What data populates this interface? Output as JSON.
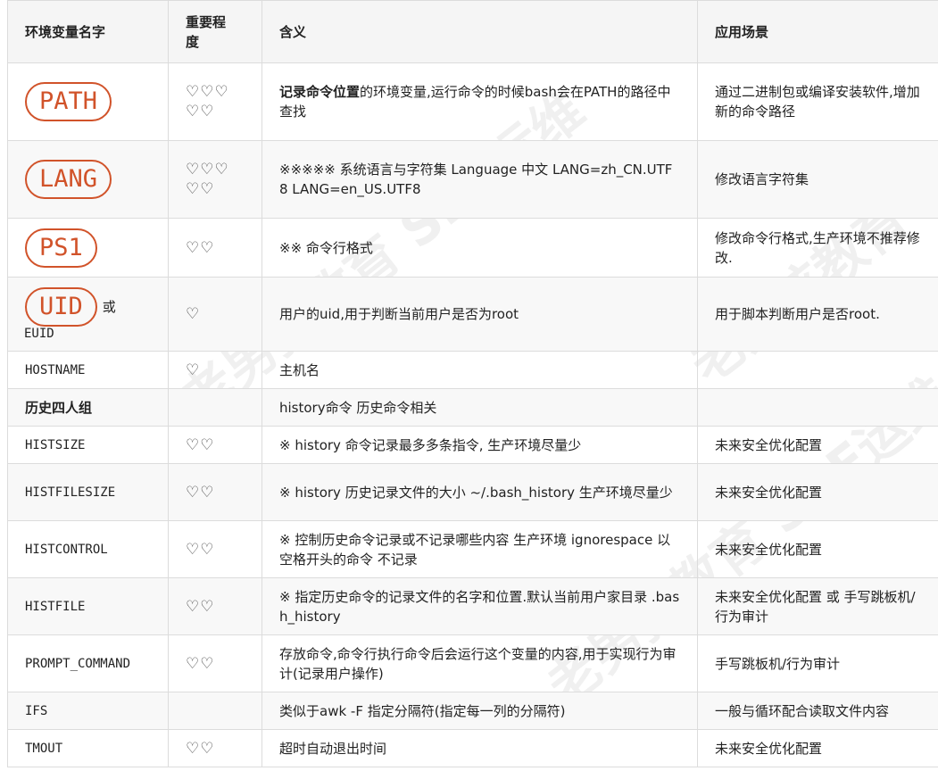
{
  "headers": [
    "环境变量名字",
    "重要程度",
    "含义",
    "应用场景"
  ],
  "watermark": "老男孩教育 SRE运维",
  "rows": [
    {
      "name": "PATH",
      "name_style": "pill",
      "extra": "",
      "hearts": "♡♡♡♡♡",
      "meaning_bold": "记录命令位置",
      "meaning": "的环境变量,运行命令的时候bash会在PATH的路径中查找",
      "scene": "通过二进制包或编译安装软件,增加新的命令路径"
    },
    {
      "name": "LANG",
      "name_style": "pill",
      "extra": "",
      "hearts": "♡♡♡♡♡",
      "meaning_bold": "",
      "meaning": "※※※※※ 系统语言与字符集 Language 中文 LANG=zh_CN.UTF8 LANG=en_US.UTF8",
      "scene": "修改语言字符集"
    },
    {
      "name": "PS1",
      "name_style": "pill",
      "extra": "",
      "hearts": "♡♡",
      "meaning_bold": "",
      "meaning": "※※ 命令行格式",
      "scene": "修改命令行格式,生产环境不推荐修改."
    },
    {
      "name": "UID",
      "name_style": "pill",
      "extra": "或",
      "extra2": "EUID",
      "hearts": "♡",
      "meaning_bold": "",
      "meaning": "用户的uid,用于判断当前用户是否为root",
      "scene": "用于脚本判断用户是否root."
    },
    {
      "name": "HOSTNAME",
      "name_style": "mono",
      "extra": "",
      "hearts": "♡",
      "meaning_bold": "",
      "meaning": "主机名",
      "scene": ""
    },
    {
      "name": "历史四人组",
      "name_style": "bold",
      "extra": "",
      "hearts": "",
      "meaning_bold": "",
      "meaning": "history命令 历史命令相关",
      "scene": ""
    },
    {
      "name": "HISTSIZE",
      "name_style": "mono",
      "extra": "",
      "hearts": "♡♡",
      "meaning_bold": "",
      "meaning": "※ history 命令记录最多多条指令, 生产环境尽量少",
      "scene": "未来安全优化配置"
    },
    {
      "name": "HISTFILESIZE",
      "name_style": "mono",
      "extra": "",
      "hearts": "♡♡",
      "meaning_bold": "",
      "meaning": "※ history 历史记录文件的大小 ~/.bash_history 生产环境尽量少",
      "scene": "未来安全优化配置"
    },
    {
      "name": "HISTCONTROL",
      "name_style": "mono",
      "extra": "",
      "hearts": "♡♡",
      "meaning_bold": "",
      "meaning": "※ 控制历史命令记录或不记录哪些内容 生产环境 ignorespace 以空格开头的命令 不记录",
      "scene": "未来安全优化配置"
    },
    {
      "name": "HISTFILE",
      "name_style": "mono",
      "extra": "",
      "hearts": "♡♡",
      "meaning_bold": "",
      "meaning": "※ 指定历史命令的记录文件的名字和位置.默认当前用户家目录 .bash_history",
      "scene": "未来安全优化配置 或 手写跳板机/行为审计"
    },
    {
      "name": "PROMPT_COMMAND",
      "name_style": "mono",
      "extra": "",
      "hearts": "♡♡",
      "meaning_bold": "",
      "meaning": "存放命令,命令行执行命令后会运行这个变量的内容,用于实现行为审计(记录用户操作)",
      "scene": "手写跳板机/行为审计"
    },
    {
      "name": "IFS",
      "name_style": "mono",
      "extra": "",
      "hearts": "",
      "meaning_bold": "",
      "meaning": "类似于awk -F 指定分隔符(指定每一列的分隔符)",
      "scene": "一般与循环配合读取文件内容"
    },
    {
      "name": "TMOUT",
      "name_style": "mono",
      "extra": "",
      "hearts": "♡♡",
      "meaning_bold": "",
      "meaning": "超时自动退出时间",
      "scene": "未来安全优化配置"
    }
  ]
}
